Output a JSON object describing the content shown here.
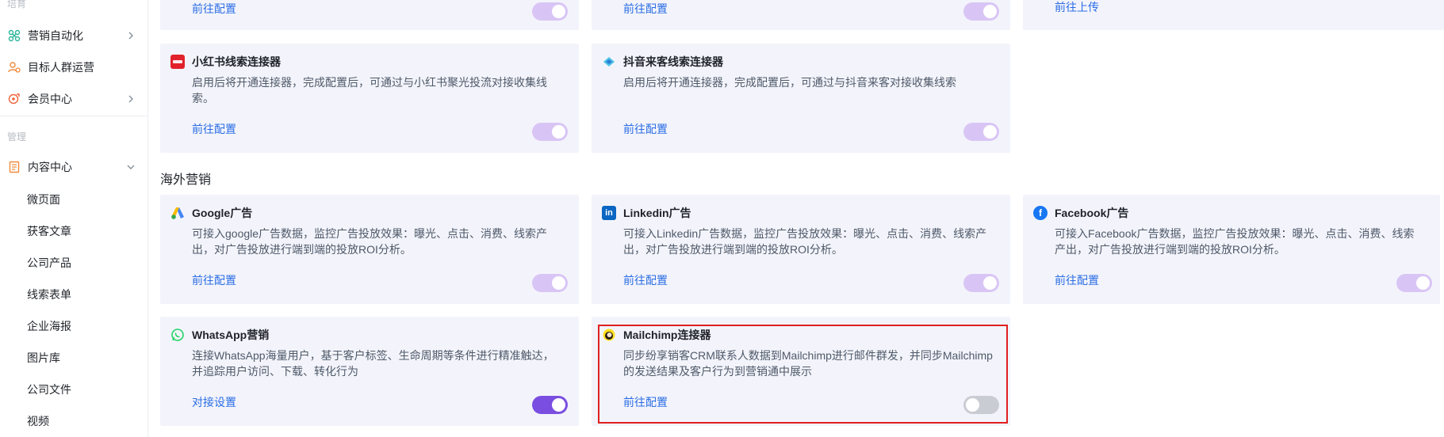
{
  "sidebar": {
    "group_top": "培育",
    "items": [
      {
        "label": "营销自动化"
      },
      {
        "label": "目标人群运营"
      },
      {
        "label": "会员中心"
      }
    ],
    "group_manage": "管理",
    "content_center": {
      "label": "内容中心"
    },
    "sub_items": [
      "微页面",
      "获客文章",
      "公司产品",
      "线索表单",
      "企业海报",
      "图片库",
      "公司文件",
      "视频"
    ]
  },
  "top_partial": {
    "link1": "前往配置",
    "link2": "前往配置",
    "link3": "前往上传"
  },
  "cards_row1": [
    {
      "title": "小红书线索连接器",
      "desc": "启用后将开通连接器，完成配置后，可通过与小红书聚光投流对接收集线索。",
      "link": "前往配置",
      "logo_text": "小红书",
      "toggle": "on"
    },
    {
      "title": "抖音来客线索连接器",
      "desc": "启用后将开通连接器，完成配置后，可通过与抖音来客对接收集线索",
      "link": "前往配置",
      "toggle": "on"
    }
  ],
  "section_overseas": "海外营销",
  "cards_row2": [
    {
      "title": "Google广告",
      "desc": "可接入google广告数据，监控广告投放效果：曝光、点击、消费、线索产出，对广告投放进行端到端的投放ROI分析。",
      "link": "前往配置",
      "toggle": "on"
    },
    {
      "title": "Linkedin广告",
      "desc": "可接入Linkedin广告数据，监控广告投放效果：曝光、点击、消费、线索产出，对广告投放进行端到端的投放ROI分析。",
      "link": "前往配置",
      "toggle": "on"
    },
    {
      "title": "Facebook广告",
      "desc": "可接入Facebook广告数据，监控广告投放效果：曝光、点击、消费、线索产出，对广告投放进行端到端的投放ROI分析。",
      "link": "前往配置",
      "toggle": "on"
    }
  ],
  "cards_row3": [
    {
      "title": "WhatsApp营销",
      "desc": "连接WhatsApp海量用户，基于客户标签、生命周期等条件进行精准触达，并追踪用户访问、下载、转化行为",
      "link": "对接设置",
      "toggle": "on"
    },
    {
      "title": "Mailchimp连接器",
      "desc": "同步纷享销客CRM联系人数据到Mailchimp进行邮件群发，并同步Mailchimp的发送结果及客户行为到营销通中展示",
      "link": "前往配置",
      "toggle": "off"
    }
  ],
  "colors": {
    "accent": "#7a4ee0",
    "link": "#2b6de5",
    "card_bg": "#f3f4fb",
    "highlight": "#e02020"
  }
}
